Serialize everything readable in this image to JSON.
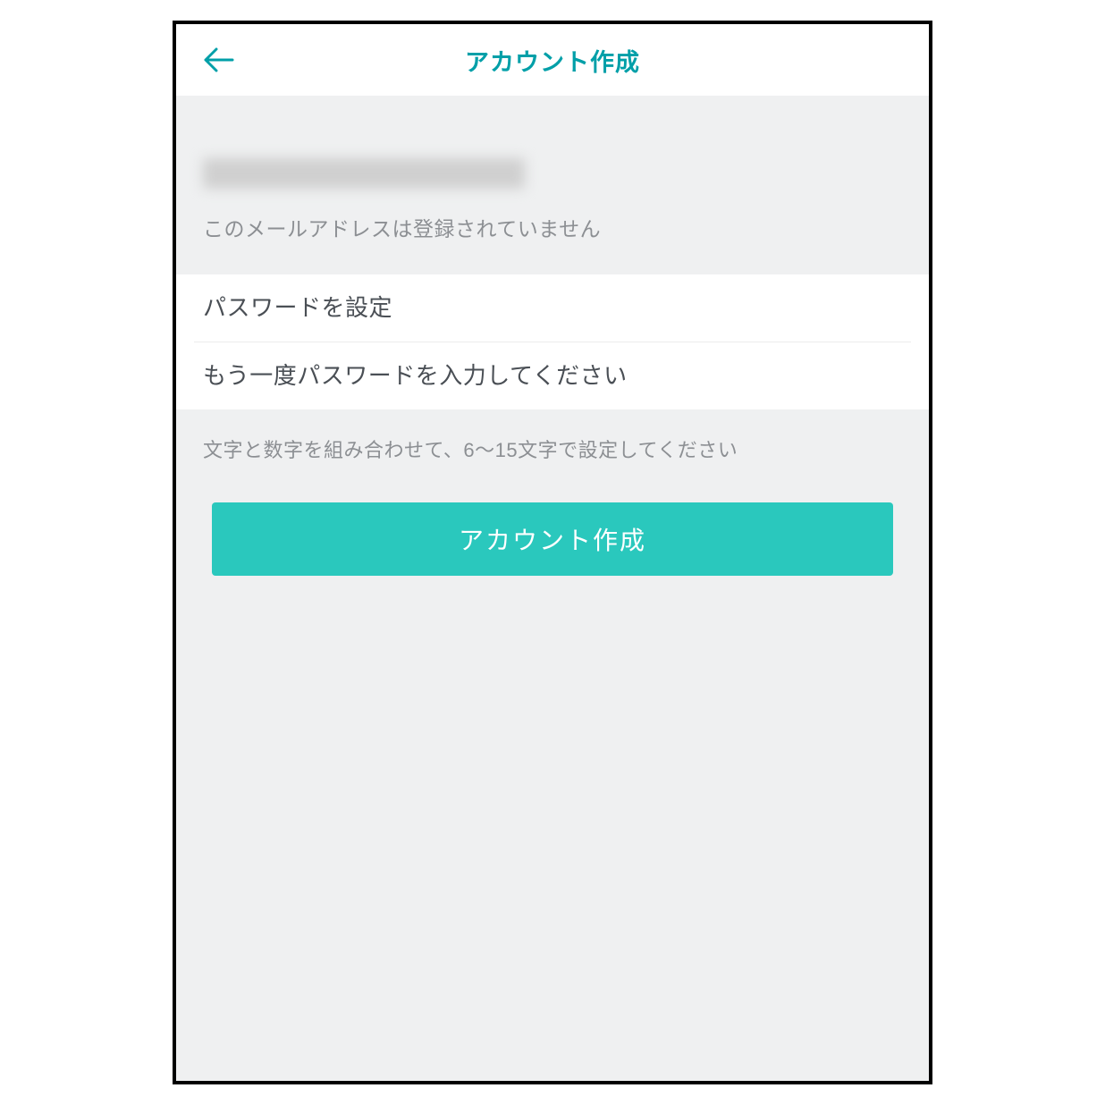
{
  "header": {
    "title": "アカウント作成"
  },
  "email": {
    "note": "このメールアドレスは登録されていません"
  },
  "form": {
    "password_placeholder": "パスワードを設定",
    "password_confirm_placeholder": "もう一度パスワードを入力してください",
    "hint": "文字と数字を組み合わせて、6～15文字で設定してください",
    "submit_label": "アカウント作成"
  },
  "colors": {
    "accent": "#009fa8",
    "button": "#2ac8bd",
    "background": "#eff0f1",
    "muted_text": "#8c8f93"
  }
}
